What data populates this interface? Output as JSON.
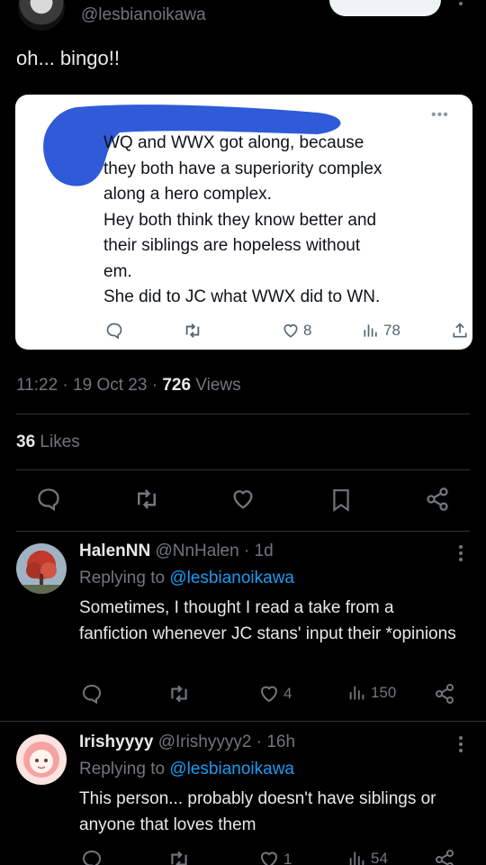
{
  "tweet": {
    "handle": "@lesbianoikawa",
    "text": "oh... bingo!!",
    "time": "11:22",
    "date": "19 Oct 23",
    "views_count": "726",
    "views_label": "Views",
    "likes_count": "36",
    "likes_label": "Likes"
  },
  "quoted_image": {
    "text": "WQ and WWX got along, because\nthey both have a superiority complex\nalong a hero complex.\nHey both think they know better and\ntheir siblings are hopeless without\nem.\nShe did to JC what WWX did to WN.",
    "likes": "8",
    "views": "78"
  },
  "replies": [
    {
      "name": "HalenNN",
      "handle": "@NnHalen",
      "time": "1d",
      "replying_label": "Replying to",
      "replying_to": "@lesbianoikawa",
      "text": "Sometimes, I thought I read a take from a fanfiction whenever JC stans' input their *opinions",
      "likes": "4",
      "views": "150"
    },
    {
      "name": "Irishyyyy",
      "handle": "@Irishyyyy2",
      "time": "16h",
      "replying_label": "Replying to",
      "replying_to": "@lesbianoikawa",
      "text": "This person... probably doesn't have siblings or anyone that loves them",
      "likes": "1",
      "views": "54"
    }
  ],
  "colors": {
    "background": "#000000",
    "text": "#e7e9ea",
    "muted": "#71767b",
    "accent": "#1d9bf0",
    "scribble": "#2f5bd8"
  }
}
